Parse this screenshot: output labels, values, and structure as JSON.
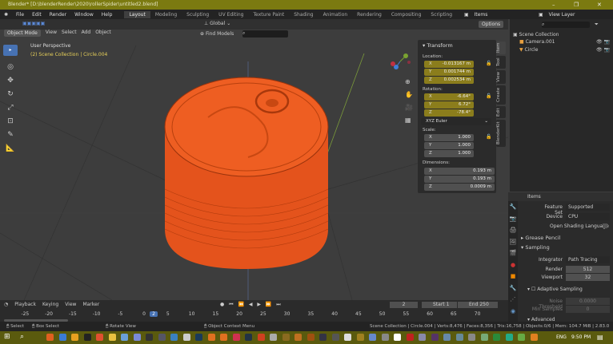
{
  "window": {
    "title": "Blender* [D:\\blenderRender\\2020\\rollerSpider\\untitled2.blend]"
  },
  "menu": [
    "File",
    "Edit",
    "Render",
    "Window",
    "Help"
  ],
  "workspaces": [
    {
      "label": "Layout",
      "active": true
    },
    {
      "label": "Modeling"
    },
    {
      "label": "Sculpting"
    },
    {
      "label": "UV Editing"
    },
    {
      "label": "Texture Paint"
    },
    {
      "label": "Shading"
    },
    {
      "label": "Animation"
    },
    {
      "label": "Rendering"
    },
    {
      "label": "Compositing"
    },
    {
      "label": "Scripting"
    }
  ],
  "topright": {
    "scene": "Items",
    "view_layer": "View Layer"
  },
  "viewport": {
    "mode": "Object Mode",
    "menus": [
      "View",
      "Select",
      "Add",
      "Object"
    ],
    "orientation": "Global",
    "find": "Find Models",
    "options": "Options",
    "perspective": "User Perspective",
    "collection_info": "(2) Scene Collection | Circle.004",
    "object_color": "#e8561e"
  },
  "npanel": {
    "title": "Transform",
    "location_label": "Location:",
    "location": [
      {
        "axis": "X",
        "value": "-0.013167 m"
      },
      {
        "axis": "Y",
        "value": "0.001744 m"
      },
      {
        "axis": "Z",
        "value": "0.002534 m"
      }
    ],
    "rotation_label": "Rotation:",
    "rotation": [
      {
        "axis": "X",
        "value": "-6.64°"
      },
      {
        "axis": "Y",
        "value": "6.72°"
      },
      {
        "axis": "Z",
        "value": "-78.4°"
      }
    ],
    "rotation_mode": "XYZ Euler",
    "scale_label": "Scale:",
    "scale": [
      {
        "axis": "X",
        "value": "1.000"
      },
      {
        "axis": "Y",
        "value": "1.000"
      },
      {
        "axis": "Z",
        "value": "1.000"
      }
    ],
    "dimensions_label": "Dimensions:",
    "dimensions": [
      {
        "axis": "X",
        "value": "0.193 m"
      },
      {
        "axis": "Y",
        "value": "0.193 m"
      },
      {
        "axis": "Z",
        "value": "0.0009 m"
      }
    ],
    "tabs": [
      "Item",
      "Tool",
      "View",
      "Create",
      "Edit",
      "BlenderKit"
    ]
  },
  "outliner": {
    "root": "Scene Collection",
    "items": [
      "Camera.001",
      "Circle"
    ]
  },
  "properties": {
    "scene": "Items",
    "feature_set_label": "Feature Set",
    "feature_set": "Supported",
    "device_label": "Device",
    "device": "CPU",
    "osl": "Open Shading Language",
    "grease_pencil": "Grease Pencil",
    "sampling": "Sampling",
    "integrator_label": "Integrator",
    "integrator": "Path Tracing",
    "render_label": "Render",
    "render": "512",
    "viewport_label": "Viewport",
    "viewport": "32",
    "adaptive": "Adaptive Sampling",
    "noise_label": "Noise Threshold",
    "noise": "0.0000",
    "min_label": "Min Samples",
    "min": "0",
    "advanced": "Advanced"
  },
  "timeline": {
    "menus": [
      "Playback",
      "Keying",
      "View",
      "Marker"
    ],
    "current_frame": "2",
    "start_label": "Start",
    "start": "1",
    "end_label": "End",
    "end": "250",
    "ticks": [
      "-25",
      "-20",
      "-15",
      "-10",
      "-5",
      "0",
      "2",
      "5",
      "10",
      "15",
      "20",
      "25",
      "30",
      "35",
      "40",
      "45",
      "50",
      "55",
      "60",
      "65",
      "70"
    ]
  },
  "status": {
    "select": "Select",
    "box_select": "Box Select",
    "rotate": "Rotate View",
    "context": "Object Context Menu",
    "stats": "Scene Collection | Circle.004 | Verts:8,476 | Faces:8,356 | Tris:16,758 | Objects:0/6 | Mem: 104.7 MiB | 2.83.0 Beta"
  },
  "taskbar": {
    "lang": "ENG",
    "time": "9:50 PM"
  }
}
